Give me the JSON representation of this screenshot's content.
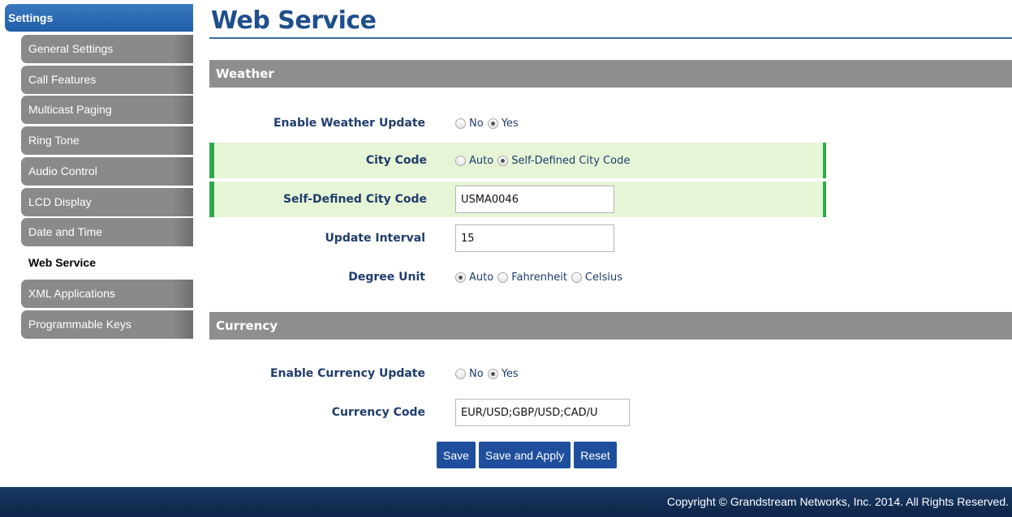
{
  "sidebar": {
    "header": "Settings",
    "items": [
      {
        "label": "General Settings"
      },
      {
        "label": "Call Features"
      },
      {
        "label": "Multicast Paging"
      },
      {
        "label": "Ring Tone"
      },
      {
        "label": "Audio Control"
      },
      {
        "label": "LCD Display"
      },
      {
        "label": "Date and Time"
      },
      {
        "label": "Web Service",
        "active": true
      },
      {
        "label": "XML Applications"
      },
      {
        "label": "Programmable Keys"
      }
    ]
  },
  "page": {
    "title": "Web Service"
  },
  "weather": {
    "section_title": "Weather",
    "enable_label": "Enable Weather Update",
    "enable_no": "No",
    "enable_yes": "Yes",
    "enable_value": "Yes",
    "city_code_label": "City Code",
    "city_code_auto": "Auto",
    "city_code_self": "Self-Defined City Code",
    "city_code_value": "Self-Defined City Code",
    "self_city_label": "Self-Defined City Code",
    "self_city_value": "USMA0046",
    "interval_label": "Update Interval",
    "interval_value": "15",
    "degree_label": "Degree Unit",
    "degree_auto": "Auto",
    "degree_fahrenheit": "Fahrenheit",
    "degree_celsius": "Celsius",
    "degree_value": "Auto"
  },
  "currency": {
    "section_title": "Currency",
    "enable_label": "Enable Currency Update",
    "enable_no": "No",
    "enable_yes": "Yes",
    "enable_value": "Yes",
    "code_label": "Currency Code",
    "code_value": "EUR/USD;GBP/USD;CAD/U"
  },
  "buttons": {
    "save": "Save",
    "save_apply": "Save and Apply",
    "reset": "Reset"
  },
  "footer": {
    "copyright": "Copyright © Grandstream Networks, Inc. 2014. All Rights Reserved."
  },
  "colors": {
    "nav_bg": "#8a8a8a",
    "header_blue": "#1f5ea8",
    "title_blue": "#1f4f8c",
    "section_bg": "#8e8e8e",
    "highlight_bg": "#e6f5d6",
    "highlight_border": "#2fa84a",
    "button_blue": "#1f4f9c",
    "footer_bg": "#0d2447"
  }
}
